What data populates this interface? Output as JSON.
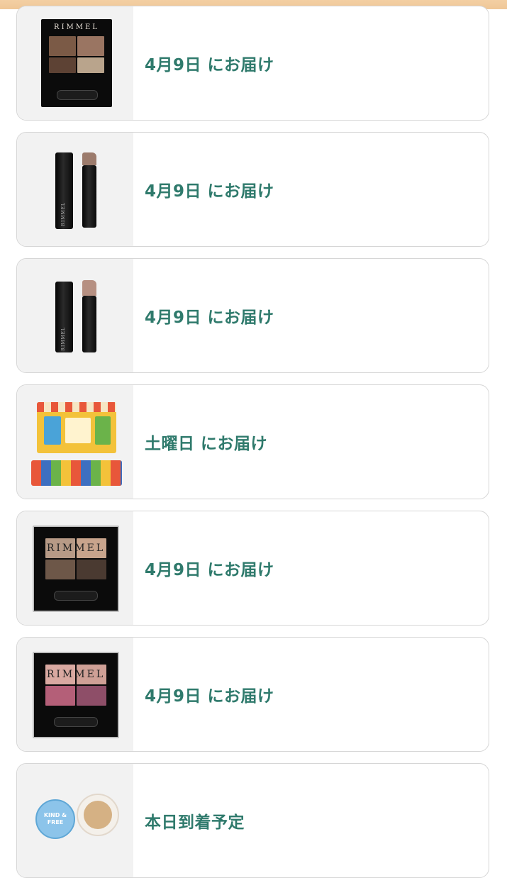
{
  "orders": [
    {
      "status": "4月9日 にお届け",
      "product_icon": "eyeshadow-palette-brown",
      "brand": "RIMMEL",
      "colors": [
        "#7b5a46",
        "#9a7562",
        "#5d4234",
        "#b9a48c"
      ]
    },
    {
      "status": "4月9日 にお届け",
      "product_icon": "lipstick-nude",
      "brand": "RIMMEL",
      "colors": [
        "#9c7b6c"
      ]
    },
    {
      "status": "4月9日 にお届け",
      "product_icon": "lipstick-beige",
      "brand": "RIMMEL",
      "colors": [
        "#b69082"
      ]
    },
    {
      "status": "土曜日 にお届け",
      "product_icon": "snack-box",
      "colors": [
        "#f3c23a",
        "#e8573a",
        "#6bb34a",
        "#3e6fc0"
      ]
    },
    {
      "status": "4月9日 にお届け",
      "product_icon": "eyeshadow-palette-taupe",
      "brand": "RIMMEL",
      "colors": [
        "#b79a86",
        "#c8a48c",
        "#6d5748",
        "#4a3a31"
      ]
    },
    {
      "status": "4月9日 にお届け",
      "product_icon": "eyeshadow-palette-pink",
      "brand": "RIMMEL",
      "colors": [
        "#d9a9a1",
        "#cfa096",
        "#b45f78",
        "#8e4e68"
      ]
    },
    {
      "status": "本日到着予定",
      "product_icon": "compact-powder",
      "brand": "KIND & FREE",
      "colors": [
        "#8cc4ea",
        "#d5b184"
      ]
    }
  ],
  "theme": {
    "status_color": "#2f7a6c",
    "header_color": "#f1cb9c"
  }
}
